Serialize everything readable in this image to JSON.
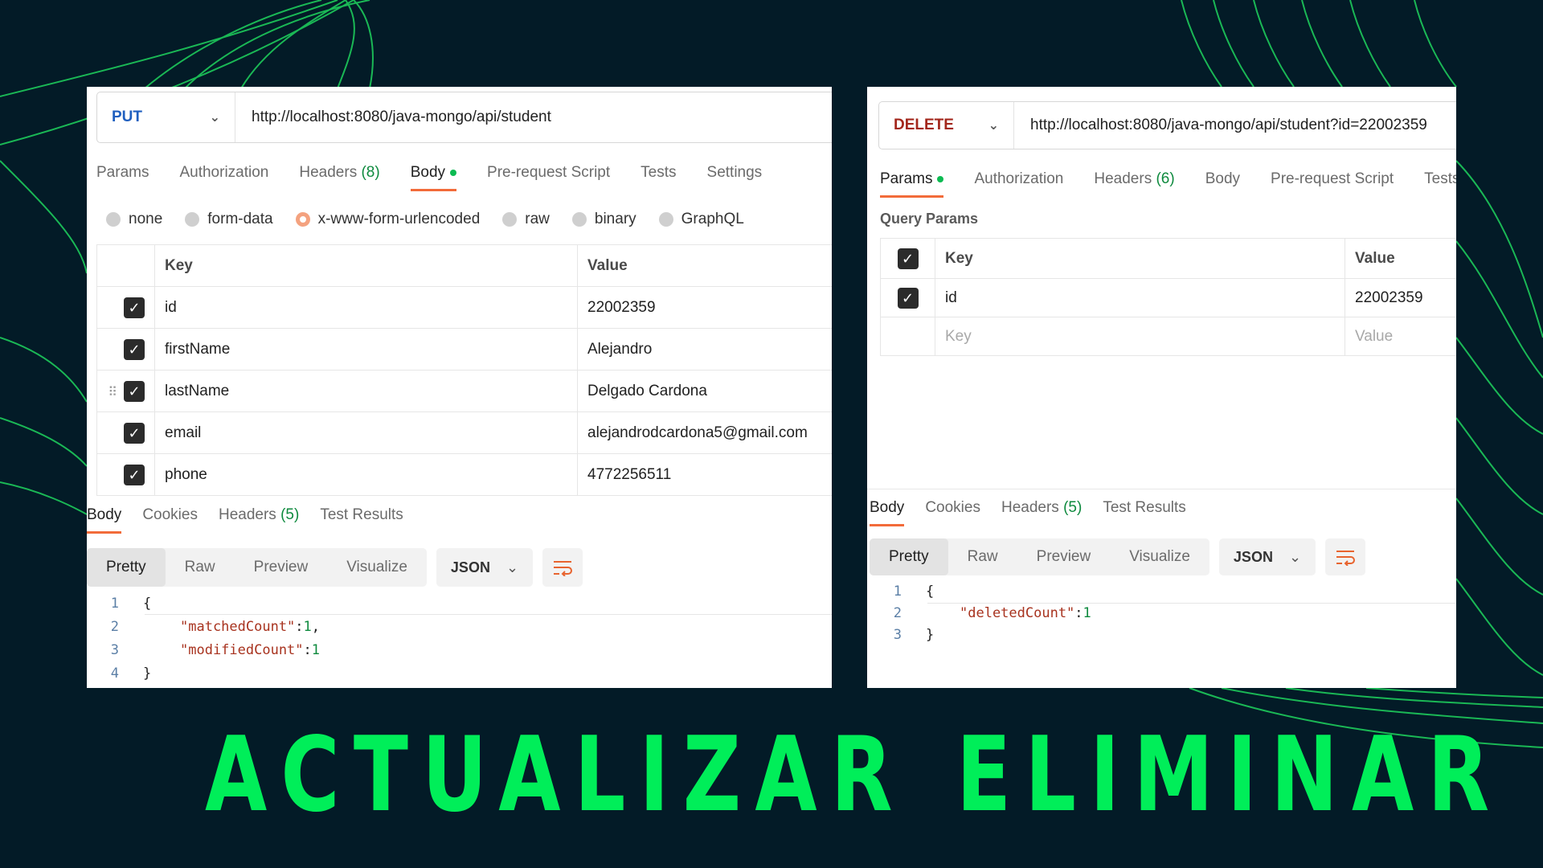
{
  "update": {
    "request": {
      "method": "PUT",
      "url": "http://localhost:8080/java-mongo/api/student",
      "method_color": "#1f5fbf"
    },
    "tabs": [
      {
        "label": "Params"
      },
      {
        "label": "Authorization"
      },
      {
        "label": "Headers",
        "count": "(8)"
      },
      {
        "label": "Body",
        "active": true,
        "dot": true
      },
      {
        "label": "Pre-request Script"
      },
      {
        "label": "Tests"
      },
      {
        "label": "Settings"
      }
    ],
    "body_types": [
      "none",
      "form-data",
      "x-www-form-urlencoded",
      "raw",
      "binary",
      "GraphQL"
    ],
    "body_type_selected": "x-www-form-urlencoded",
    "table": {
      "key_header": "Key",
      "value_header": "Value",
      "rows": [
        {
          "key": "id",
          "value": "22002359"
        },
        {
          "key": "firstName",
          "value": "Alejandro"
        },
        {
          "key": "lastName",
          "value": "Delgado Cardona"
        },
        {
          "key": "email",
          "value": "alejandrodcardona5@gmail.com"
        },
        {
          "key": "phone",
          "value": "4772256511"
        }
      ]
    },
    "response_tabs": [
      {
        "label": "Body",
        "active": true
      },
      {
        "label": "Cookies"
      },
      {
        "label": "Headers",
        "count": "(5)"
      },
      {
        "label": "Test Results"
      }
    ],
    "view_modes": [
      "Pretty",
      "Raw",
      "Preview",
      "Visualize"
    ],
    "format": "JSON",
    "code": {
      "open": "{",
      "close": "}",
      "entries": [
        {
          "key": "\"matchedCount\"",
          "value": "1",
          "sep": ","
        },
        {
          "key": "\"modifiedCount\"",
          "value": "1",
          "sep": ""
        }
      ]
    },
    "caption": "ACTUALIZAR"
  },
  "delete": {
    "request": {
      "method": "DELETE",
      "url": "http://localhost:8080/java-mongo/api/student?id=22002359",
      "method_color": "#a3271c"
    },
    "tabs": [
      {
        "label": "Params",
        "active": true,
        "dot": true
      },
      {
        "label": "Authorization"
      },
      {
        "label": "Headers",
        "count": "(6)"
      },
      {
        "label": "Body"
      },
      {
        "label": "Pre-request Script"
      },
      {
        "label": "Tests"
      }
    ],
    "query_params_title": "Query Params",
    "table": {
      "key_header": "Key",
      "value_header": "Value",
      "rows": [
        {
          "key": "id",
          "value": "22002359"
        }
      ],
      "placeholder_key": "Key",
      "placeholder_value": "Value"
    },
    "response_tabs": [
      {
        "label": "Body",
        "active": true
      },
      {
        "label": "Cookies"
      },
      {
        "label": "Headers",
        "count": "(5)"
      },
      {
        "label": "Test Results"
      }
    ],
    "view_modes": [
      "Pretty",
      "Raw",
      "Preview",
      "Visualize"
    ],
    "format": "JSON",
    "code": {
      "open": "{",
      "close": "}",
      "entries": [
        {
          "key": "\"deletedCount\"",
          "value": "1",
          "sep": ""
        }
      ]
    },
    "caption": "ELIMINAR"
  },
  "colors": {
    "background": "#031b27",
    "accent_green": "#00ee59",
    "tab_underline": "#f26b3a"
  },
  "icons": {
    "dropdown": "chevron-down-icon",
    "checkbox": "checkmark-icon",
    "wrap": "wrap-lines-icon",
    "drag": "drag-handle-icon"
  }
}
